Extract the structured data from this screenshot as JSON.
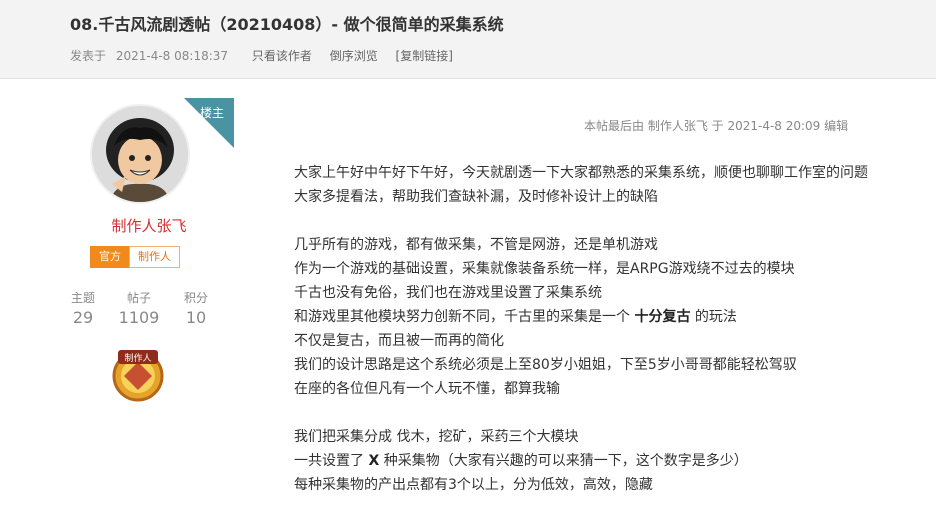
{
  "thread": {
    "title": "08.千古风流剧透帖（20210408）- 做个很简单的采集系统",
    "posted_prefix": "发表于",
    "posted_date": "2021-4-8 08:18:37",
    "link_author_only": "只看该作者",
    "link_reverse": "倒序浏览",
    "link_copy": "[复制链接]"
  },
  "author": {
    "name": "制作人张飞",
    "op_tag": "楼主",
    "badge_official": "官方",
    "badge_role": "制作人",
    "stat_labels": [
      "主题",
      "帖子",
      "积分"
    ],
    "stat_values": [
      "29",
      "1109",
      "10"
    ],
    "medal_text": "制作人"
  },
  "post": {
    "edited_note": "本帖最后由 制作人张飞 于 2021-4-8 20:09 编辑",
    "lines": [
      {
        "text": "大家上午好中午好下午好，今天就剧透一下大家都熟悉的采集系统，顺便也聊聊工作室的问题"
      },
      {
        "text": "大家多提看法，帮助我们查缺补漏，及时修补设计上的缺陷"
      },
      {
        "text": ""
      },
      {
        "text": "几乎所有的游戏，都有做采集，不管是网游，还是单机游戏"
      },
      {
        "text": "作为一个游戏的基础设置，采集就像装备系统一样，是ARPG游戏绕不过去的模块"
      },
      {
        "text": "千古也没有免俗，我们也在游戏里设置了采集系统"
      },
      {
        "pre": "和游戏里其他模块努力创新不同，千古里的采集是一个 ",
        "bold": "十分复古",
        "post": " 的玩法"
      },
      {
        "text": "不仅是复古，而且被一而再的简化"
      },
      {
        "text": "我们的设计思路是这个系统必须是上至80岁小姐姐，下至5岁小哥哥都能轻松驾驭"
      },
      {
        "text": "在座的各位但凡有一个人玩不懂，都算我输"
      },
      {
        "text": ""
      },
      {
        "text": "我们把采集分成 伐木，挖矿，采药三个大模块"
      },
      {
        "pre": "一共设置了 ",
        "bold": "X",
        "post": " 种采集物（大家有兴趣的可以来猜一下，这个数字是多少）"
      },
      {
        "text": "每种采集物的产出点都有3个以上，分为低效，高效，隐藏"
      }
    ]
  },
  "colors": {
    "username": "#d23030",
    "op_ribbon": "#4a93a3",
    "badge_official": "#f08a1c",
    "header_bg": "#f3f3f3"
  },
  "icons": {
    "avatar": "cartoon-avatar",
    "medal": "producer-medal-icon"
  }
}
